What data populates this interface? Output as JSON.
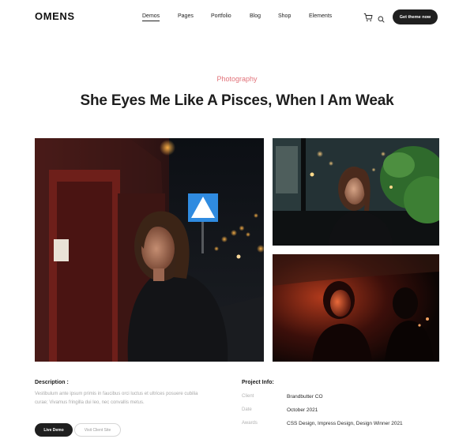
{
  "header": {
    "logo": "OMENS",
    "nav": [
      {
        "label": "Demos",
        "active": true
      },
      {
        "label": "Pages",
        "active": false
      },
      {
        "label": "Portfolio",
        "active": false
      },
      {
        "label": "Blog",
        "active": false
      },
      {
        "label": "Shop",
        "active": false
      },
      {
        "label": "Elements",
        "active": false
      }
    ],
    "cart_icon": "cart-icon",
    "search_icon": "search-icon",
    "cta_label": "Get theme now"
  },
  "project": {
    "category": "Photography",
    "title": "She Eyes Me Like A Pisces, When I Am Weak"
  },
  "description": {
    "label": "Description :",
    "text": "Vestibulum ante ipsum primis in faucibus orci luctus et ultrices posuere cubilia curae; Vivamus fringilla dui leo, nec convallis metus.",
    "live_demo_label": "Live Demo",
    "visit_site_label": "Visit Client Site"
  },
  "info": {
    "label": "Project Info:",
    "rows": [
      {
        "key": "Client",
        "value": "Brandbutter CO"
      },
      {
        "key": "Date",
        "value": "October 2021"
      },
      {
        "key": "Awards",
        "value": "CSS Design, Impress Design, Design Winner 2021"
      }
    ]
  },
  "colors": {
    "accent": "#e2737a",
    "dark_button": "#1f1f1f"
  }
}
